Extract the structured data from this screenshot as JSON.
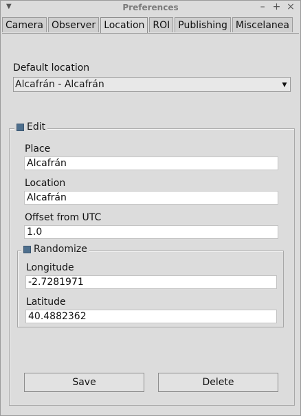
{
  "window": {
    "title": "Preferences"
  },
  "tabs": [
    "Camera",
    "Observer",
    "Location",
    "ROI",
    "Publishing",
    "Miscelanea"
  ],
  "default_location": {
    "label": "Default location",
    "value": "Alcafrán - Alcafrán"
  },
  "edit": {
    "label": "Edit",
    "place": {
      "label": "Place",
      "value": "Alcafrán"
    },
    "location": {
      "label": "Location",
      "value": "Alcafrán"
    },
    "offset": {
      "label": "Offset from UTC",
      "value": "1.0"
    },
    "randomize": {
      "label": "Randomize",
      "longitude": {
        "label": "Longitude",
        "value": "-2.7281971"
      },
      "latitude": {
        "label": "Latitude",
        "value": "40.4882362"
      }
    }
  },
  "buttons": {
    "save": "Save",
    "delete": "Delete"
  }
}
